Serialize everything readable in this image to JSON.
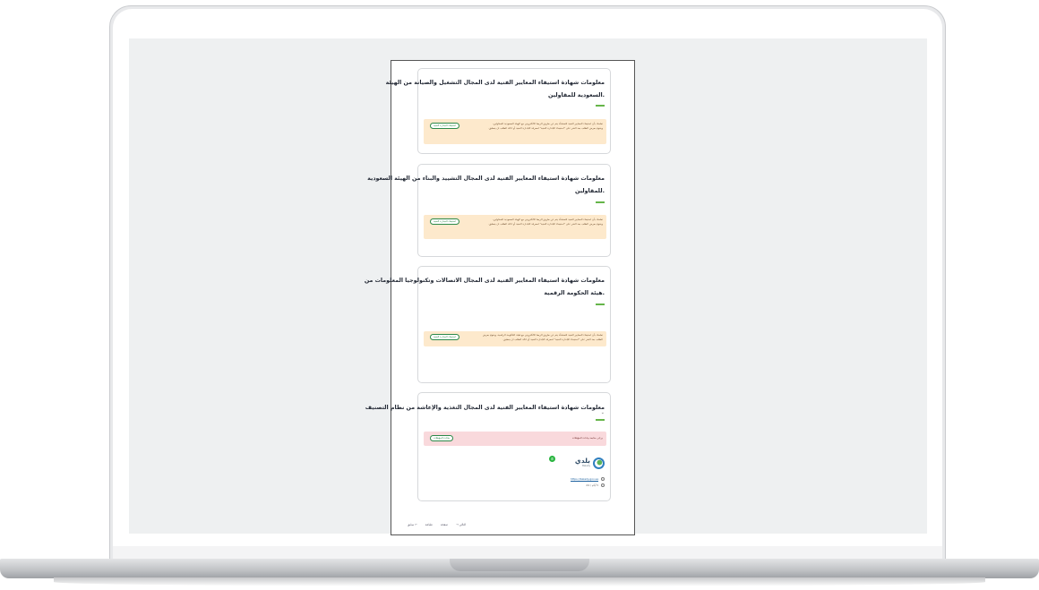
{
  "cards": [
    {
      "title_line1": "معلومات شهادة استيفاء المعايير الفنية لدى المجال التشغيل والصيانة من الهيئة",
      "title_line2": ".السعودية للمقاولين",
      "note": "تعلمك بأن استيفاء المعايير الفنية للمنشأة يتم عن طريق الربط الالكتروني مع الهيئة السعودية للمقاولين، ويقوم بعرض الطلب بعد النقر على \"استيفاء الجدارة الفنية\" لمعرفة الجدارة الفنية أو حالة الطلب ان ينطبق.",
      "button": "استيفاء الجدارة الفنية"
    },
    {
      "title_line1": "معلومات شهادة استيفاء المعايير الفنية لدى المجال التشييد والبناء من الهيئة السعودية",
      "title_line2": ".للمقاولين",
      "note": "تعلمك بأن استيفاء المعايير الفنية للمنشأة يتم عن طريق الربط الالكتروني مع الهيئة السعودية للمقاولين، ويقوم بعرض الطلب بعد النقر على \"استيفاء الجدارة الفنية\" لمعرفة الجدارة الفنية أو حالة الطلب ان ينطبق.",
      "button": "استيفاء الجدارة الفنية"
    },
    {
      "title_line1": "معلومات شهادة استيفاء المعايير الفنية لدى المجال الاتصالات وتكنولوجيا المعلومات من",
      "title_line2": ".هيئة الحكومة الرقمية",
      "note": "تعلمك بأن استيفاء المعايير الفنية للمنشأة يتم عن طريق الربط الالكتروني مع هيئة الحكومة الرقمية، ويقوم بعرض الطلب بعد النقر على \"استيفاء الجدارة الفنية\" لمعرفة الجدارة الفنية أو حالة الطلب ان ينطبق.",
      "button": "استيفاء الجدارة الفنية"
    },
    {
      "title_line1": "معلومات شهادة استيفاء المعايير الفنية لدى المجال التغذية والإعاشة من نظام التصنيف",
      "note": "يرجى متابعة بيانات المؤهلات",
      "button": "بيانات المؤهلات"
    }
  ],
  "contact": {
    "brand": "بلدي",
    "brand_sub": "Balady",
    "link": "https://balady.gov.sa",
    "hours": "٧ أيام / 24"
  },
  "pager": {
    "prev": "← سابق",
    "print": "طباعة",
    "page": "صفحة",
    "next": "التالي →"
  },
  "colors": {
    "accent": "#66b54a",
    "note_bg": "#fde9cc",
    "alert_bg": "#f9d9dc",
    "button": "#2c8a4a"
  }
}
